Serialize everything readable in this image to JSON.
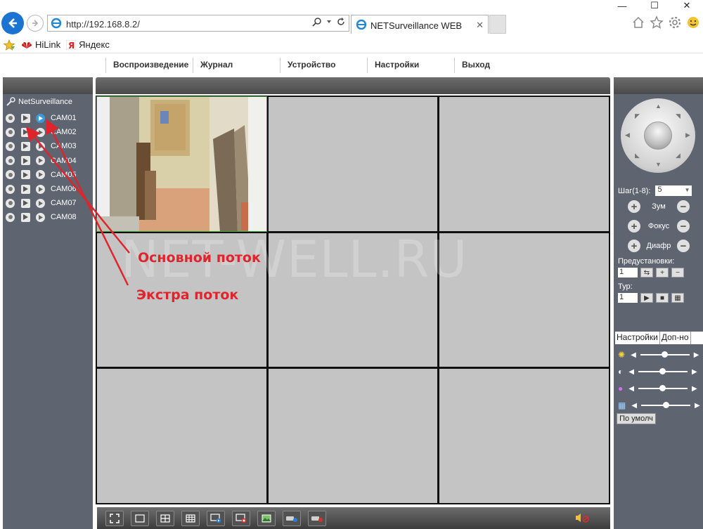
{
  "browser": {
    "url": "http://192.168.8.2/",
    "tab_title": "NETSurveillance WEB",
    "tab_close": "✕",
    "favorites": [
      {
        "label": "HiLink"
      },
      {
        "label": "Яндекс"
      }
    ]
  },
  "menu": {
    "items": [
      "Воспроизведение",
      "Журнал",
      "Устройство",
      "Настройки",
      "Выход"
    ]
  },
  "left_panel": {
    "root_label": "NetSurveillance",
    "cameras": [
      "CAM01",
      "CAM02",
      "CAM03",
      "CAM04",
      "CAM05",
      "CAM06",
      "CAM07",
      "CAM08"
    ]
  },
  "watermark": "NET-WELL.RU",
  "ptz": {
    "step_label": "Шаг(1-8):",
    "step_value": "5",
    "zoom_label": "Зум",
    "focus_label": "Фокус",
    "iris_label": "Диафр",
    "presets_label": "Предустановки:",
    "preset_value": "1",
    "tour_label": "Тур:",
    "tour_value": "1"
  },
  "settings": {
    "tab_settings": "Настройки",
    "tab_extra": "Доп-но",
    "default_button": "По умолч",
    "sliders": [
      {
        "icon": "brightness-icon",
        "value": 0.5
      },
      {
        "icon": "contrast-icon",
        "value": 0.5
      },
      {
        "icon": "saturation-icon",
        "value": 0.5
      },
      {
        "icon": "hue-icon",
        "value": 0.5
      }
    ]
  },
  "annotations": {
    "main_stream": "Основной поток",
    "extra_stream": "Экстра поток"
  },
  "colors": {
    "accent": "#1b74d1",
    "panel": "#5e6470",
    "annotation": "#e0242b",
    "active_cell_border": "#3aa63a"
  }
}
